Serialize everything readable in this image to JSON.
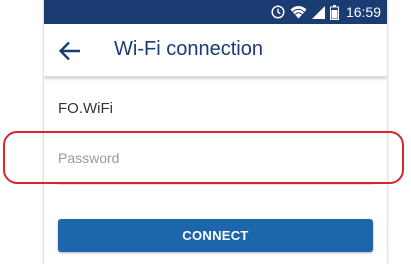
{
  "status_bar": {
    "time": "16:59",
    "icons": [
      "alarm-icon",
      "wifi-icon",
      "signal-icon",
      "battery-icon"
    ],
    "background": "#1b3c73"
  },
  "app_bar": {
    "title": "Wi-Fi connection",
    "back_icon": "arrow-left-icon"
  },
  "network": {
    "ssid": "FO.WiFi"
  },
  "password_field": {
    "placeholder": "Password",
    "value": ""
  },
  "connect_button": {
    "label": "CONNECT",
    "color": "#1d66ab"
  },
  "annotation": {
    "highlight_color": "#d6272e"
  }
}
